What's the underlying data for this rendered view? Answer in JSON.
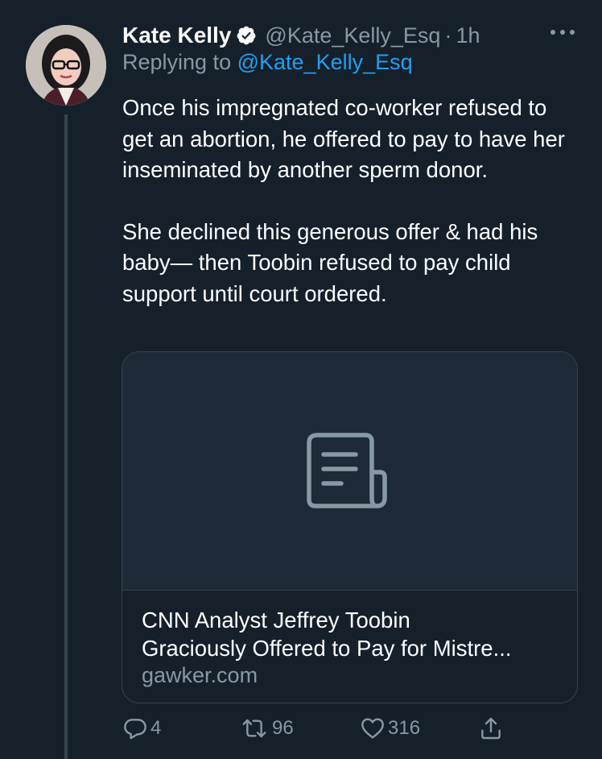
{
  "tweet": {
    "author_name": "Kate Kelly",
    "handle": "@Kate_Kelly_Esq",
    "separator": "·",
    "time": "1h",
    "replying_prefix": "Replying to",
    "replying_handle": "@Kate_Kelly_Esq",
    "paragraphs": [
      "Once his impregnated co-worker refused to get an abortion, he offered to pay to have her inseminated by another sperm donor.",
      "She declined this generous offer & had his baby— then Toobin refused to pay child support until court ordered."
    ]
  },
  "card": {
    "title_line1": "CNN Analyst Jeffrey Toobin",
    "title_line2": "Graciously Offered to Pay for Mistre...",
    "domain": "gawker.com",
    "icon": "document-icon"
  },
  "actions": {
    "reply_count": "4",
    "retweet_count": "96",
    "like_count": "316"
  },
  "colors": {
    "background": "#15202b",
    "secondary_text": "#8899a6",
    "link": "#1da1f2",
    "border": "#38444d"
  }
}
